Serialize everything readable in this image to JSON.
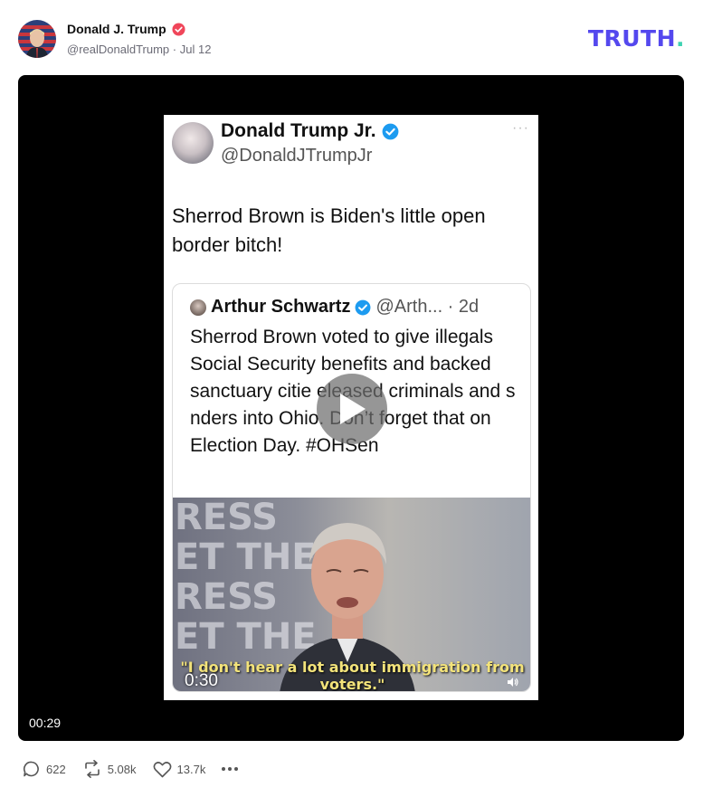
{
  "post": {
    "author_name": "Donald J. Trump",
    "author_handle": "@realDonaldTrump",
    "date": "Jul 12",
    "separator": "·",
    "brand": "TRUTH",
    "brand_dot": ".",
    "avatar_icon": "avatar-photo",
    "verified_icon": "verified-badge-icon",
    "colors": {
      "brand": "#5448ee",
      "brand_dot": "#3fd3b2",
      "verified": "#f0465a"
    }
  },
  "video": {
    "elapsed": "00:29",
    "play_icon": "play-icon",
    "embedded_post": {
      "author_name": "Donald Trump Jr.",
      "author_handle": "@DonaldJTrumpJr",
      "menu": "···",
      "text": "Sherrod Brown is Biden's little open border bitch!",
      "quote": {
        "author_name": "Arthur Schwartz",
        "author_handle": "@Arth... · 2d",
        "text": "Sherrod Brown voted to give illegals Social Security benefits and backed sanctuary citie     eleased criminals and s       nders into Ohio. Don’t forget that on Election Day. #OHSen",
        "clip": {
          "background_text": "RESS\nET THE\nRESS\nET THE",
          "caption": "\"I don't hear a lot about immigration from voters.\"",
          "time": "0:30",
          "speaker_icon": "speaker-icon"
        }
      }
    }
  },
  "actions": {
    "replies": "622",
    "retruths": "5.08k",
    "likes": "13.7k",
    "reply_icon": "comment-icon",
    "retruth_icon": "repost-icon",
    "like_icon": "heart-icon",
    "more_icon": "more-icon"
  }
}
